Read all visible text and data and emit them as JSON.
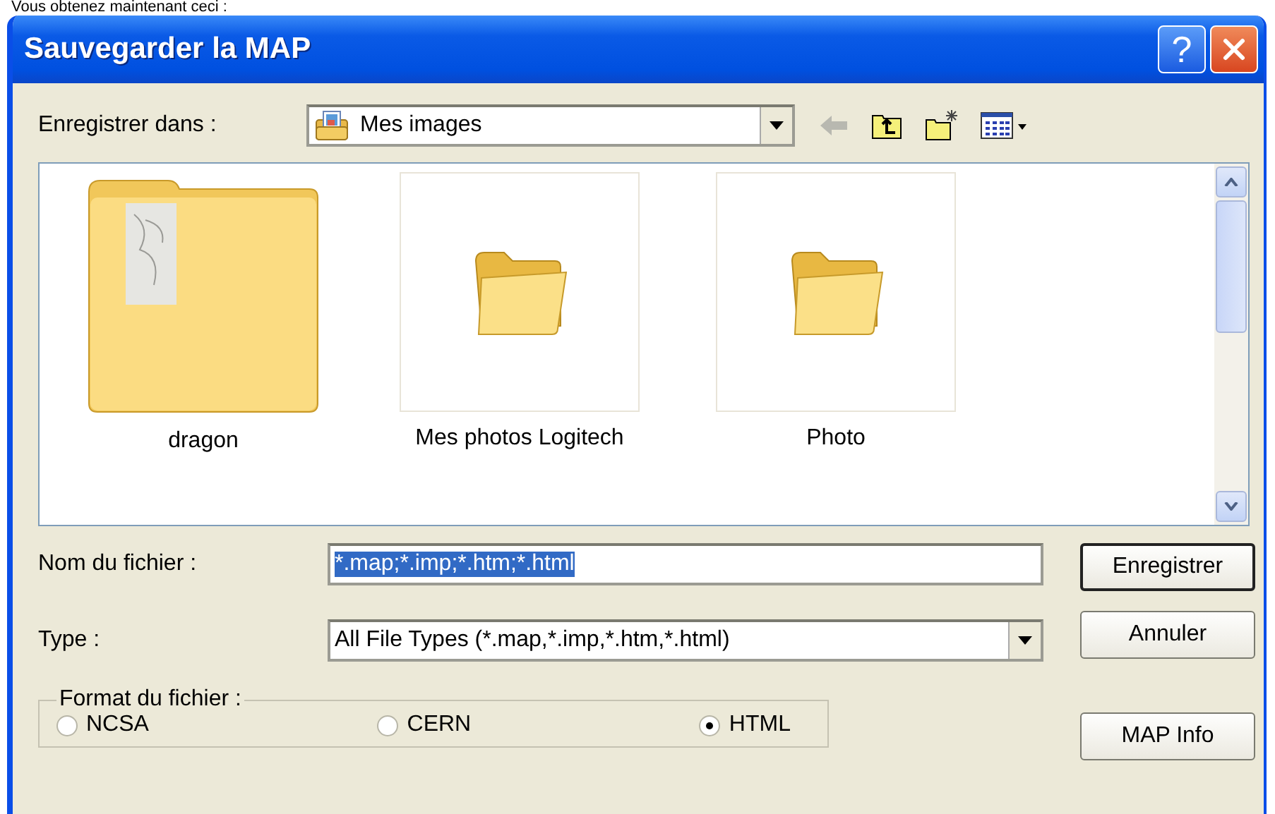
{
  "caption": "Vous obtenez maintenant ceci :",
  "window": {
    "title": "Sauvegarder la MAP",
    "help_glyph": "?"
  },
  "save_in": {
    "label": "Enregistrer dans :",
    "value": "Mes images"
  },
  "files": [
    {
      "name": "dragon",
      "kind": "thumbnail"
    },
    {
      "name": "Mes photos Logitech",
      "kind": "folder"
    },
    {
      "name": "Photo",
      "kind": "folder"
    }
  ],
  "file_name": {
    "label": "Nom du fichier :",
    "value": "*.map;*.imp;*.htm;*.html"
  },
  "file_type": {
    "label": "Type :",
    "value": "All File Types (*.map,*.imp,*.htm,*.html)"
  },
  "format": {
    "legend": "Format du fichier :",
    "options": [
      {
        "label": "NCSA",
        "selected": false
      },
      {
        "label": "CERN",
        "selected": false
      },
      {
        "label": "HTML",
        "selected": true
      }
    ]
  },
  "buttons": [
    "Enregistrer",
    "Annuler",
    "MAP Info"
  ]
}
